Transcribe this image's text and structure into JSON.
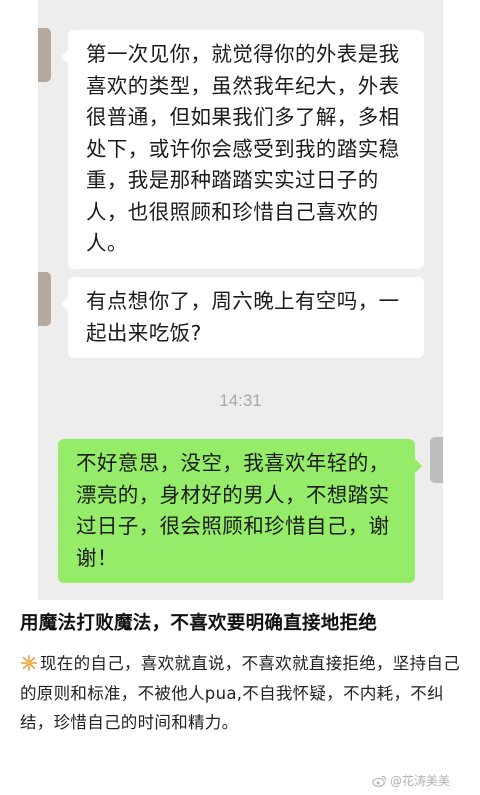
{
  "chat": {
    "messages": [
      {
        "side": "in",
        "text": "第一次见你，就觉得你的外表是我喜欢的类型，虽然我年纪大，外表很普通，但如果我们多了解，多相处下，或许你会感受到我的踏实稳重，我是那种踏踏实实过日子的人，也很照顾和珍惜自己喜欢的人。"
      },
      {
        "side": "in",
        "text": "有点想你了，周六晚上有空吗，一起出来吃饭?"
      },
      {
        "side": "out",
        "text": "不好意思，没空，我喜欢年轻的，漂亮的，身材好的男人，不想踏实过日子，很会照顾和珍惜自己，谢谢！"
      }
    ],
    "timestamp": "14:31",
    "colors": {
      "background": "#ededed",
      "incoming": "#ffffff",
      "outgoing": "#95ec69"
    }
  },
  "post": {
    "title": "用魔法打败魔法，不喜欢要明确直接地拒绝",
    "emoji_icon": "firework-sparkler-icon",
    "body": "现在的自己，喜欢就直说，不喜欢就直接拒绝，坚持自己的原则和标准，不被他人pua,不自我怀疑，不内耗，不纠结，珍惜自己的时间和精力。"
  },
  "watermark": {
    "icon": "weibo-icon",
    "text": "@花涛美美"
  }
}
